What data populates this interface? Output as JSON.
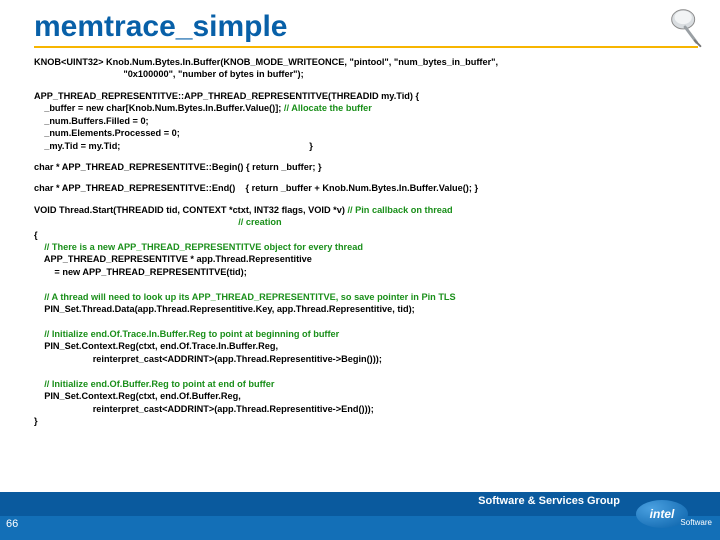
{
  "title": "memtrace_simple",
  "footer": {
    "group": "Software & Services Group",
    "brand": "intel",
    "sub": "Software"
  },
  "page": "66",
  "code": {
    "knob_a": "KNOB<UINT32> Knob.Num.Bytes.In.Buffer(KNOB_MODE_WRITEONCE, \"pintool\", \"num_bytes_in_buffer\",",
    "knob_b": "                                   \"0x100000\", \"number of bytes in buffer\");",
    "ctor1": "APP_THREAD_REPRESENTITVE::APP_THREAD_REPRESENTITVE(THREADID my.Tid) {",
    "ctor2": "    _buffer = new char[Knob.Num.Bytes.In.Buffer.Value()]; ",
    "ctor2c": "// Allocate the buffer",
    "ctor3": "    _num.Buffers.Filled = 0;",
    "ctor4": "    _num.Elements.Processed = 0;",
    "ctor5": "    _my.Tid = my.Tid;                                                                          }",
    "begin": "char * APP_THREAD_REPRESENTITVE::Begin() { return _buffer; }",
    "end": "char * APP_THREAD_REPRESENTITVE::End()    { return _buffer + Knob.Num.Bytes.In.Buffer.Value(); }",
    "ts1": "VOID Thread.Start(THREADID tid, CONTEXT *ctxt, INT32 flags, VOID *v) ",
    "ts1c": "// Pin callback on thread",
    "ts1d": "                                                                                // creation",
    "open": "{",
    "c1": "    // There is a new APP_THREAD_REPRESENTITVE object for every thread",
    "l1": "    APP_THREAD_REPRESENTITVE * app.Thread.Representitive",
    "l2": "        = new APP_THREAD_REPRESENTITVE(tid);",
    "c2": "    // A thread will need to look up its APP_THREAD_REPRESENTITVE, so save pointer in Pin TLS",
    "l3": "    PIN_Set.Thread.Data(app.Thread.Representitive.Key, app.Thread.Representitive, tid);",
    "c3": "    // Initialize end.Of.Trace.In.Buffer.Reg to point at beginning of buffer",
    "l4": "    PIN_Set.Context.Reg(ctxt, end.Of.Trace.In.Buffer.Reg,",
    "l5": "                       reinterpret_cast<ADDRINT>(app.Thread.Representitive->Begin()));",
    "c4": "    // Initialize end.Of.Buffer.Reg to point at end of buffer",
    "l6": "    PIN_Set.Context.Reg(ctxt, end.Of.Buffer.Reg,",
    "l7": "                       reinterpret_cast<ADDRINT>(app.Thread.Representitive->End()));",
    "close": "}"
  }
}
